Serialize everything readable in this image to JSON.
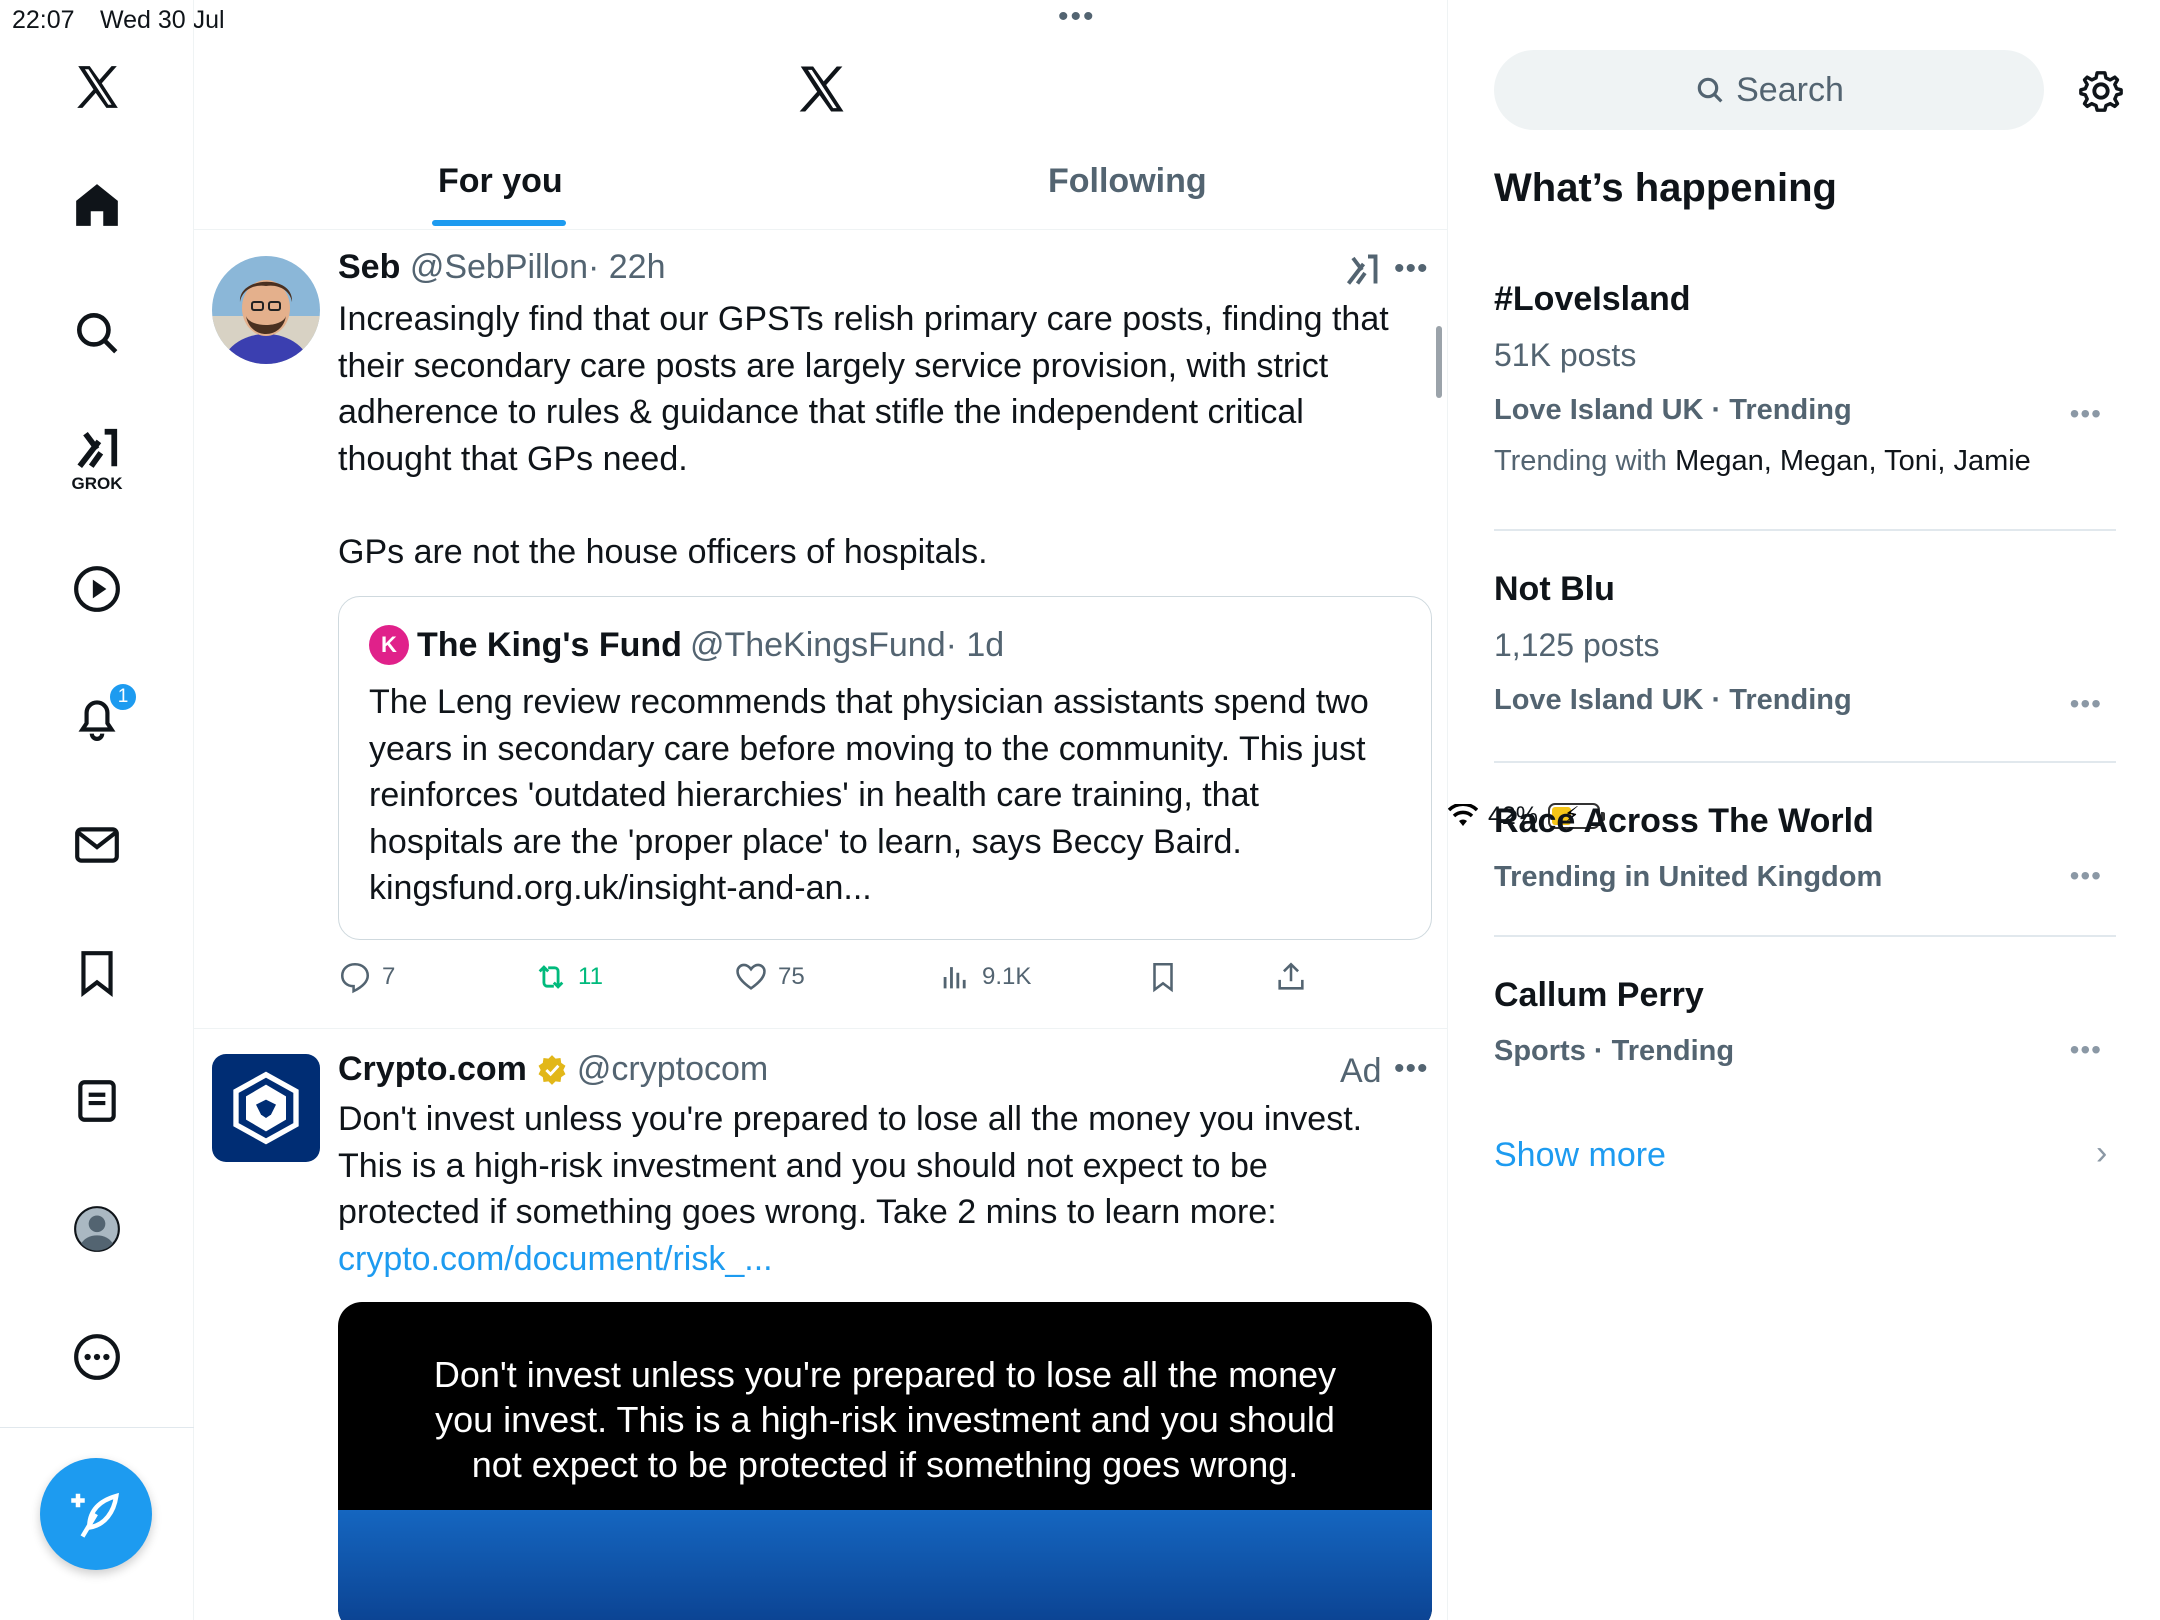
{
  "status_bar": {
    "time": "22:07",
    "date": "Wed 30 Jul",
    "battery": "42%"
  },
  "nav": {
    "grok_label": "GROK",
    "notification_count": "1"
  },
  "tabs": [
    {
      "label": "For you"
    },
    {
      "label": "Following"
    }
  ],
  "posts": [
    {
      "name": "Seb",
      "handle": "@SebPillon",
      "time": "· 22h",
      "body_lines": [
        "Increasingly find that our GPSTs relish primary care posts, finding that",
        "their secondary care posts are largely service provision, with strict",
        "adherence to rules & guidance that stifle the independent critical",
        "thought that GPs need.",
        "",
        "GPs are not the house officers of hospitals."
      ],
      "quote": {
        "name": "The King's Fund",
        "handle": "@TheKingsFund",
        "time": "· 1d",
        "body_lines": [
          "The Leng review recommends that physician assistants spend two",
          "years in secondary care before moving to the community. This just",
          "reinforces 'outdated hierarchies' in health care training, that",
          "hospitals are the 'proper place' to learn, says Beccy Baird.",
          "kingsfund.org.uk/insight-and-an..."
        ]
      },
      "stats": {
        "replies": "7",
        "reposts": "11",
        "likes": "75",
        "views": "9.1K"
      }
    },
    {
      "name": "Crypto.com",
      "handle": "@cryptocom",
      "ad": "Ad",
      "body_lines": [
        "Don't invest unless you're prepared to lose all the money you invest.",
        "This is a high-risk investment and you should not expect to be",
        "protected if something goes wrong. Take 2 mins to learn more:"
      ],
      "link": "crypto.com/document/risk_...",
      "media_lines": [
        "Don't invest unless you're prepared to lose all the money",
        "you invest. This is a high-risk investment and you should",
        "not expect to be protected if something goes wrong."
      ]
    }
  ],
  "sidebar": {
    "search_placeholder": "Search",
    "title": "What’s happening",
    "trends": [
      {
        "name": "#LoveIsland",
        "count": "51K posts",
        "category": "Love Island UK · Trending",
        "with_label": "Trending with",
        "with_names": "Megan, Megan, Toni, Jamie"
      },
      {
        "name": "Not Blu",
        "count": "1,125 posts",
        "category": "Love Island UK · Trending"
      },
      {
        "name": "Race Across The World",
        "category": "Trending in United Kingdom"
      },
      {
        "name": "Callum Perry",
        "category": "Sports · Trending"
      }
    ],
    "show_more": "Show more"
  },
  "colors": {
    "accent": "#1d9bf0",
    "repost": "#00ba7c",
    "text": "#0f1419",
    "muted": "#536471"
  }
}
